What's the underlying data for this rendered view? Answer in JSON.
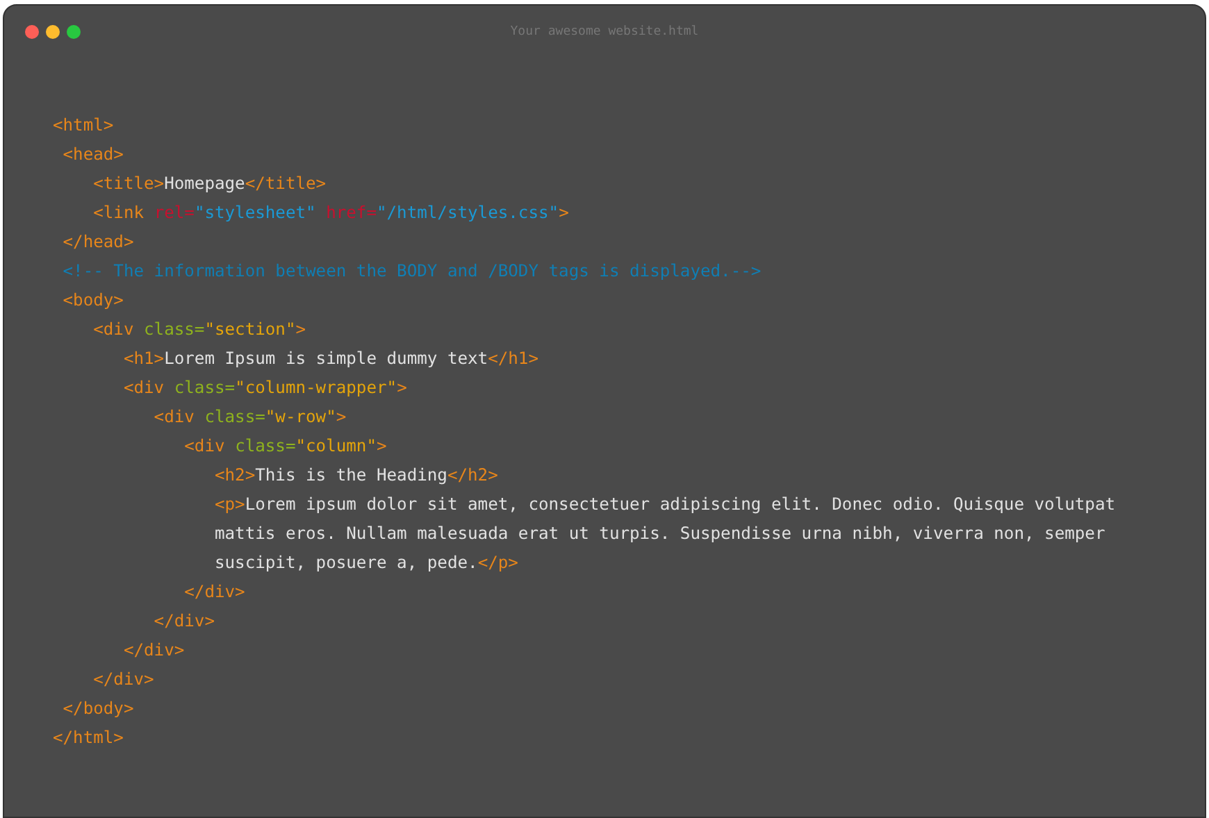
{
  "window": {
    "title": "Your awesome website.html"
  },
  "code_lines": [
    [
      {
        "kind": "tag",
        "text": "<html>"
      }
    ],
    [
      {
        "kind": "tag",
        "text": " <head>"
      }
    ],
    [
      {
        "kind": "tag",
        "text": "    <title>"
      },
      {
        "kind": "text",
        "text": "Homepage"
      },
      {
        "kind": "tag",
        "text": "</title>"
      }
    ],
    [
      {
        "kind": "tag",
        "text": "    <link "
      },
      {
        "kind": "attr_red",
        "text": "rel="
      },
      {
        "kind": "string_blue",
        "text": "\"stylesheet\" "
      },
      {
        "kind": "attr_red",
        "text": "href="
      },
      {
        "kind": "string_blue",
        "text": "\"/html/styles.css\""
      },
      {
        "kind": "tag",
        "text": ">"
      }
    ],
    [
      {
        "kind": "tag",
        "text": " </head>"
      }
    ],
    [
      {
        "kind": "comment",
        "text": " <!-- The information between the BODY and /BODY tags is displayed.-->"
      }
    ],
    [
      {
        "kind": "tag",
        "text": " <body>"
      }
    ],
    [
      {
        "kind": "tag",
        "text": "    <div "
      },
      {
        "kind": "attr",
        "text": "class="
      },
      {
        "kind": "string",
        "text": "\"section\""
      },
      {
        "kind": "tag",
        "text": ">"
      }
    ],
    [
      {
        "kind": "tag",
        "text": "       <h1>"
      },
      {
        "kind": "text",
        "text": "Lorem Ipsum is simple dummy text"
      },
      {
        "kind": "tag",
        "text": "</h1>"
      }
    ],
    [
      {
        "kind": "tag",
        "text": "       <div "
      },
      {
        "kind": "attr",
        "text": "class="
      },
      {
        "kind": "string",
        "text": "\"column-wrapper\""
      },
      {
        "kind": "tag",
        "text": ">"
      }
    ],
    [
      {
        "kind": "tag",
        "text": "          <div "
      },
      {
        "kind": "attr",
        "text": "class="
      },
      {
        "kind": "string",
        "text": "\"w-row\""
      },
      {
        "kind": "tag",
        "text": ">"
      }
    ],
    [
      {
        "kind": "tag",
        "text": "             <div "
      },
      {
        "kind": "attr",
        "text": "class="
      },
      {
        "kind": "string",
        "text": "\"column\""
      },
      {
        "kind": "tag",
        "text": ">"
      }
    ],
    [
      {
        "kind": "tag",
        "text": "                <h2>"
      },
      {
        "kind": "text",
        "text": "This is the Heading"
      },
      {
        "kind": "tag",
        "text": "</h2>"
      }
    ],
    [
      {
        "kind": "tag",
        "text": "                <p>"
      },
      {
        "kind": "text",
        "text": "Lorem ipsum dolor sit amet, consectetuer adipiscing elit. Donec odio. Quisque volutpat"
      }
    ],
    [
      {
        "kind": "text",
        "text": "                mattis eros. Nullam malesuada erat ut turpis. Suspendisse urna nibh, viverra non, semper"
      }
    ],
    [
      {
        "kind": "text",
        "text": "                suscipit, posuere a, pede."
      },
      {
        "kind": "tag",
        "text": "</p>"
      }
    ],
    [
      {
        "kind": "tag",
        "text": "             </div>"
      }
    ],
    [
      {
        "kind": "tag",
        "text": "          </div>"
      }
    ],
    [
      {
        "kind": "tag",
        "text": "       </div>"
      }
    ],
    [
      {
        "kind": "tag",
        "text": "    </div>"
      }
    ],
    [
      {
        "kind": "tag",
        "text": " </body>"
      }
    ],
    [
      {
        "kind": "tag",
        "text": "</html>"
      }
    ]
  ]
}
